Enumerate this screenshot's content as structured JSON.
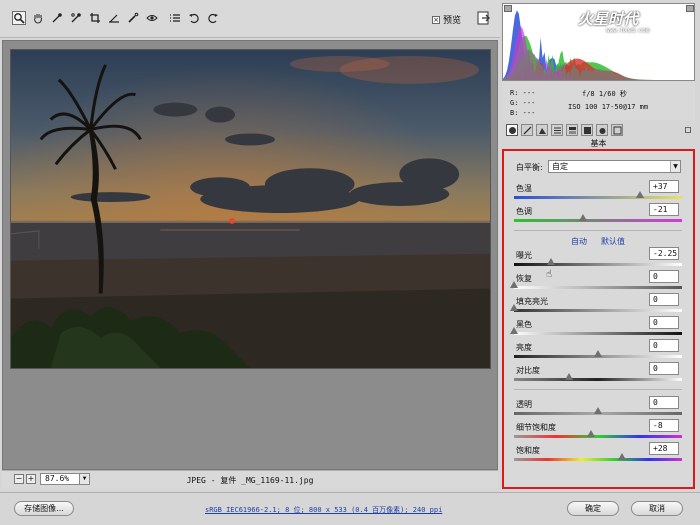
{
  "toolbar": {
    "tools": [
      "zoom-icon",
      "hand-icon",
      "eyedropper-icon",
      "color-sampler-icon",
      "crop-icon",
      "straighten-icon",
      "retouch-icon",
      "red-eye-icon",
      "list-icon",
      "rotate-left-icon",
      "rotate-right-icon"
    ],
    "preview_label": "预览",
    "preview_checked": true
  },
  "status": {
    "zoom": "87.6%",
    "filename": "JPEG - 复件 _MG_1169-11.jpg"
  },
  "info": {
    "r": "R:  ---",
    "g": "G:  ---",
    "b": "B:  ---",
    "exif_line1": "f/8   1/60 秒",
    "exif_line2": "ISO 100   17-50@17 mm"
  },
  "watermark": {
    "logo": "火星时代",
    "url": "www.hxsd.com"
  },
  "panel": {
    "title": "基本",
    "white_balance_label": "白平衡:",
    "white_balance_value": "自定",
    "temperature": {
      "label": "色温",
      "value": "+37",
      "pos": 0.75
    },
    "tint": {
      "label": "色调",
      "value": "-21",
      "pos": 0.41
    },
    "auto_link": "自动",
    "default_link": "默认值",
    "exposure": {
      "label": "曝光",
      "value": "-2.25",
      "pos": 0.22
    },
    "recovery": {
      "label": "恢复",
      "value": "0",
      "pos": 0.0
    },
    "fill_light": {
      "label": "填充亮光",
      "value": "0",
      "pos": 0.0
    },
    "blacks": {
      "label": "黑色",
      "value": "0",
      "pos": 0.0
    },
    "brightness": {
      "label": "亮度",
      "value": "0",
      "pos": 0.5
    },
    "contrast": {
      "label": "对比度",
      "value": "0",
      "pos": 0.33
    },
    "clarity": {
      "label": "透明",
      "value": "0",
      "pos": 0.5
    },
    "vibrance": {
      "label": "细节饱和度",
      "value": "-8",
      "pos": 0.46
    },
    "saturation": {
      "label": "饱和度",
      "value": "+28",
      "pos": 0.64
    }
  },
  "bottom": {
    "save_label": "存储图像...",
    "workflow": "sRGB IEC61966-2.1; 8 位; 800 x 533 (0.4 百万像素); 240 ppi",
    "ok_label": "确定",
    "cancel_label": "取消"
  }
}
